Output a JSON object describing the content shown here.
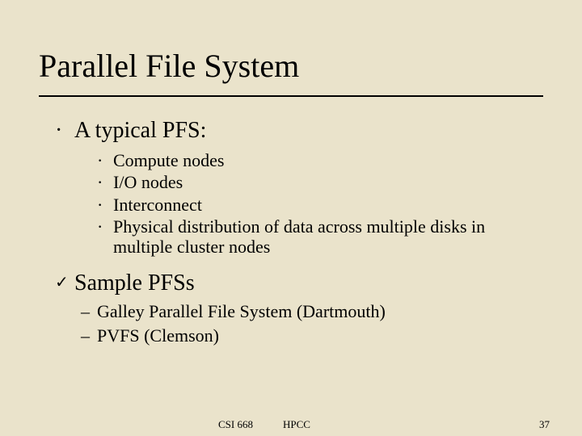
{
  "title": "Parallel File System",
  "main_bullet": "A typical PFS:",
  "sub_bullets": [
    "Compute nodes",
    "I/O nodes",
    "Interconnect",
    "Physical distribution of data across multiple disks in multiple cluster nodes"
  ],
  "check_heading": "Sample PFSs",
  "dash_items": [
    "Galley Parallel File System (Dartmouth)",
    "PVFS (Clemson)"
  ],
  "footer": {
    "course": "CSI 668",
    "topic": "HPCC",
    "page": "37"
  },
  "marks": {
    "dot": "·",
    "check": "✓",
    "dash": "–"
  }
}
